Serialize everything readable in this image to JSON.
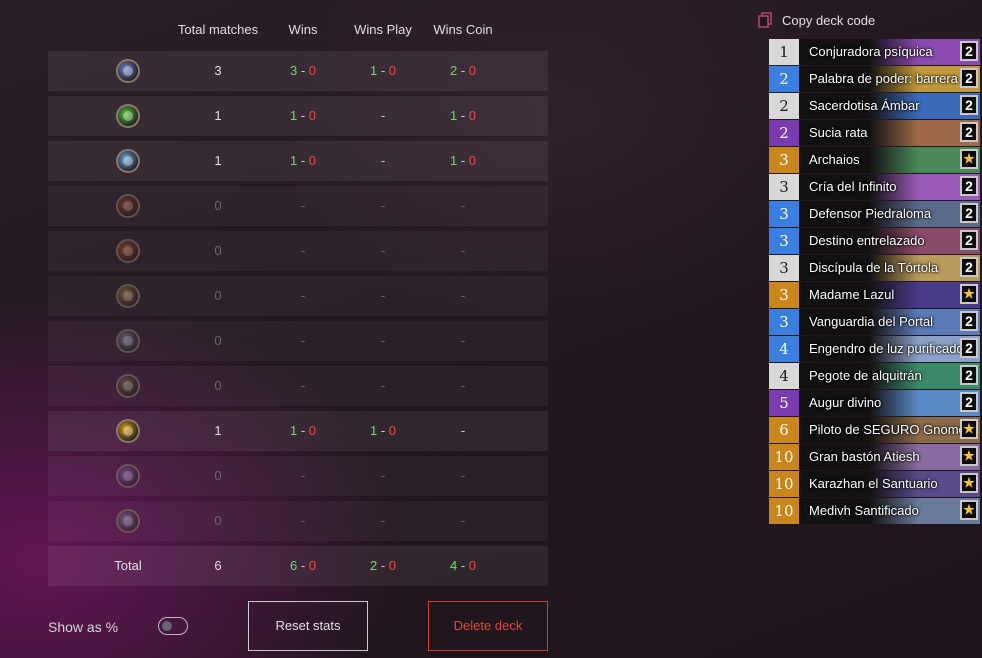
{
  "table": {
    "headers": [
      "Total matches",
      "Wins",
      "Wins Play",
      "Wins Coin"
    ],
    "sep": "-",
    "rows": [
      {
        "icon": "hero-class-1-icon",
        "color": "#6f86c8",
        "total": "3",
        "wins": [
          "3",
          "0"
        ],
        "play": [
          "1",
          "0"
        ],
        "coin": [
          "2",
          "0"
        ]
      },
      {
        "icon": "hero-class-2-icon",
        "color": "#56c23a",
        "total": "1",
        "wins": [
          "1",
          "0"
        ],
        "play": "-",
        "coin": [
          "1",
          "0"
        ]
      },
      {
        "icon": "hero-class-3-icon",
        "color": "#6aa8d8",
        "total": "1",
        "wins": [
          "1",
          "0"
        ],
        "play": "-",
        "coin": [
          "1",
          "0"
        ]
      },
      {
        "icon": "hero-class-4-icon",
        "color": "#a04a2a",
        "total": "0",
        "wins": "-",
        "play": "-",
        "coin": "-"
      },
      {
        "icon": "hero-class-5-icon",
        "color": "#c0582a",
        "total": "0",
        "wins": "-",
        "play": "-",
        "coin": "-"
      },
      {
        "icon": "hero-class-6-icon",
        "color": "#b88a4a",
        "total": "0",
        "wins": "-",
        "play": "-",
        "coin": "-"
      },
      {
        "icon": "hero-class-7-icon",
        "color": "#9090a8",
        "total": "0",
        "wins": "-",
        "play": "-",
        "coin": "-"
      },
      {
        "icon": "hero-class-8-icon",
        "color": "#8a7a50",
        "total": "0",
        "wins": "-",
        "play": "-",
        "coin": "-"
      },
      {
        "icon": "hero-class-9-icon",
        "color": "#e0a020",
        "total": "1",
        "wins": [
          "1",
          "0"
        ],
        "play": [
          "1",
          "0"
        ],
        "coin": "-"
      },
      {
        "icon": "hero-class-10-icon",
        "color": "#a070c0",
        "total": "0",
        "wins": "-",
        "play": "-",
        "coin": "-"
      },
      {
        "icon": "hero-class-11-icon",
        "color": "#8a90b0",
        "total": "0",
        "wins": "-",
        "play": "-",
        "coin": "-"
      }
    ],
    "total": {
      "label": "Total",
      "total": "6",
      "wins": [
        "6",
        "0"
      ],
      "play": [
        "2",
        "0"
      ],
      "coin": [
        "4",
        "0"
      ]
    }
  },
  "controls": {
    "show_pct_label": "Show as %",
    "show_pct_on": false,
    "reset_label": "Reset stats",
    "delete_label": "Delete deck"
  },
  "deck": {
    "copy_label": "Copy deck code",
    "rarity_colors": {
      "common": "#d8d8d8",
      "rare": "#3a7fe0",
      "epic": "#7a3ab0",
      "legendary": "#c8861c"
    },
    "cards": [
      {
        "cost": "1",
        "name": "Conjuradora psíquica",
        "count": "2",
        "rarity": "common",
        "art": "#8a4ab0"
      },
      {
        "cost": "2",
        "name": "Palabra de poder: barrera",
        "count": "2",
        "rarity": "rare",
        "art": "#c09a3a"
      },
      {
        "cost": "2",
        "name": "Sacerdotisa Ámbar",
        "count": "2",
        "rarity": "common",
        "art": "#3a6ab8"
      },
      {
        "cost": "2",
        "name": "Sucia rata",
        "count": "2",
        "rarity": "epic",
        "art": "#a06a4a"
      },
      {
        "cost": "3",
        "name": "Archaios",
        "count": "★",
        "rarity": "legendary",
        "art": "#4a8a5a"
      },
      {
        "cost": "3",
        "name": "Cría del Infinito",
        "count": "2",
        "rarity": "common",
        "art": "#9a5ab8"
      },
      {
        "cost": "3",
        "name": "Defensor Piedraloma",
        "count": "2",
        "rarity": "rare",
        "art": "#5a6a8a"
      },
      {
        "cost": "3",
        "name": "Destino entrelazado",
        "count": "2",
        "rarity": "rare",
        "art": "#8a4a6a"
      },
      {
        "cost": "3",
        "name": "Discípula de la Tórtola",
        "count": "2",
        "rarity": "common",
        "art": "#b89a5a"
      },
      {
        "cost": "3",
        "name": "Madame Lazul",
        "count": "★",
        "rarity": "legendary",
        "art": "#4a3a8a"
      },
      {
        "cost": "3",
        "name": "Vanguardia del Portal",
        "count": "2",
        "rarity": "rare",
        "art": "#5a7ab8"
      },
      {
        "cost": "4",
        "name": "Engendro de luz purificado",
        "count": "2",
        "rarity": "rare",
        "art": "#8aa0c8"
      },
      {
        "cost": "4",
        "name": "Pegote de alquitrán",
        "count": "2",
        "rarity": "common",
        "art": "#3a8a6a"
      },
      {
        "cost": "5",
        "name": "Augur divino",
        "count": "2",
        "rarity": "epic",
        "art": "#5a8ac8"
      },
      {
        "cost": "6",
        "name": "Piloto de SEGURO Gnomo",
        "count": "★",
        "rarity": "legendary",
        "art": "#8a6a4a"
      },
      {
        "cost": "10",
        "name": "Gran bastón Atiesh",
        "count": "★",
        "rarity": "legendary",
        "art": "#8a6aa0"
      },
      {
        "cost": "10",
        "name": "Karazhan el Santuario",
        "count": "★",
        "rarity": "legendary",
        "art": "#5a4a8a"
      },
      {
        "cost": "10",
        "name": "Medivh Santificado",
        "count": "★",
        "rarity": "legendary",
        "art": "#6a7a9a"
      }
    ]
  }
}
